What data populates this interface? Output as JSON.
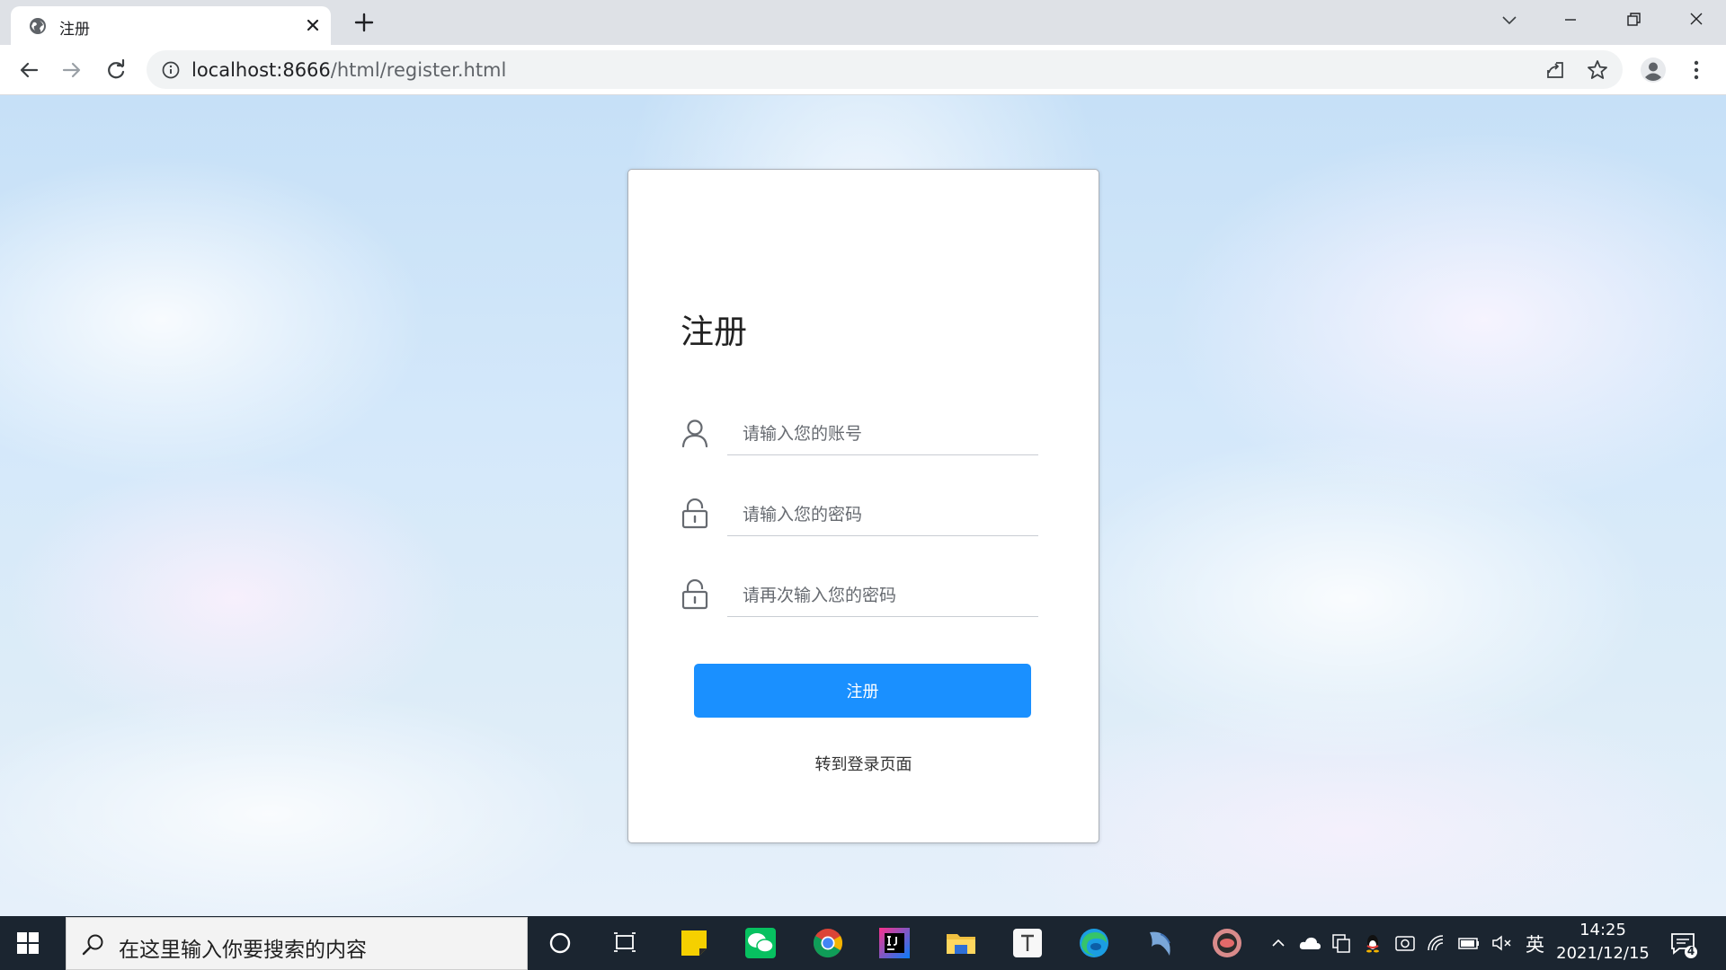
{
  "browser": {
    "tab_title": "注册",
    "url_host": "localhost:8666",
    "url_path": "/html/register.html"
  },
  "page": {
    "title": "注册",
    "fields": [
      {
        "placeholder": "请输入您的账号",
        "icon": "user-icon"
      },
      {
        "placeholder": "请输入您的密码",
        "icon": "lock-icon"
      },
      {
        "placeholder": "请再次输入您的密码",
        "icon": "lock-icon"
      }
    ],
    "submit_label": "注册",
    "switch_link": "转到登录页面",
    "accent_color": "#1a90ff"
  },
  "taskbar": {
    "search_placeholder": "在这里输入你要搜索的内容",
    "ime_indicator": "英",
    "time": "14:25",
    "date": "2021/12/15",
    "notification_count": "4"
  }
}
